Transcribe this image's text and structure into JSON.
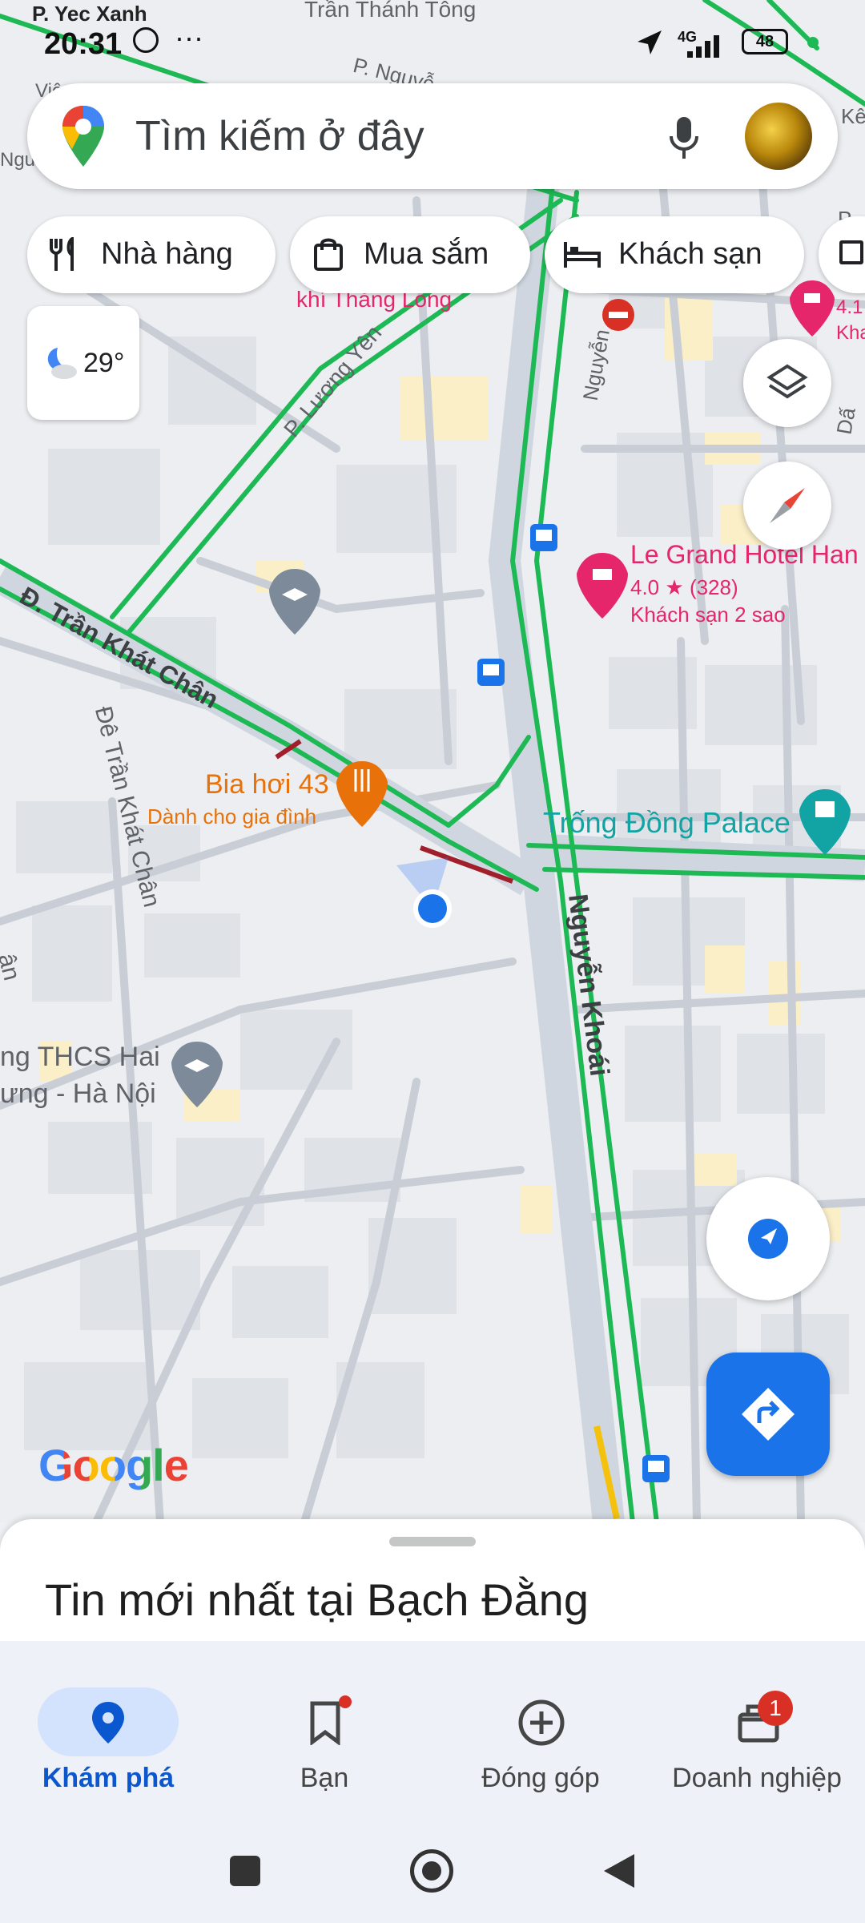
{
  "status_bar": {
    "time": "20:31",
    "network": "4G",
    "battery": "48",
    "location_label": "P. Yec Xanh"
  },
  "search": {
    "placeholder": "Tìm kiếm ở đây"
  },
  "chips": [
    {
      "label": "Nhà hàng",
      "icon": "restaurant-icon"
    },
    {
      "label": "Mua sắm",
      "icon": "shopping-bag-icon"
    },
    {
      "label": "Khách sạn",
      "icon": "hotel-icon"
    }
  ],
  "weather": {
    "temperature": "29°",
    "icon": "night-cloudy-icon"
  },
  "map_labels": {
    "street_tran_thanh_tong": "Trần Thánh Tông",
    "street_p_nguyen": "P. Nguyễ",
    "street_luong_yen": "P. Lương Yên",
    "street_nguyen_top": "Nguyễn",
    "street_tran_khat_chan": "Đ. Trần Khát Chân",
    "street_de_tran_khat_chan": "Đê Trần Khát Chân",
    "street_nguyen_khoai": "Nguyễn Khoái",
    "poi_thang_long": "khí Thăng Long",
    "poi_le_grand": "Le Grand Hotel Han",
    "poi_le_grand_rating": "4.0",
    "poi_le_grand_reviews": "(328)",
    "poi_le_grand_type": "Khách sạn 2 sao",
    "poi_right_rating": "4.1",
    "poi_right_name": "Kha",
    "poi_bia_hoi": "Bia hơi 43",
    "poi_bia_hoi_sub": "Dành cho gia đình",
    "poi_trong_dong": "Trống Đồng Palace",
    "poi_school_line1": "ng THCS Hai",
    "poi_school_line2": "ưng - Hà Nội",
    "edge_left_an": "ân",
    "edge_left_ngu": "Ngu",
    "edge_left_vie": "Việ",
    "edge_right_ke": "Kê",
    "edge_right_p": "P",
    "edge_right_dan": "Dấ"
  },
  "google_logo": "Google",
  "sheet": {
    "title": "Tin mới nhất tại Bạch Đằng"
  },
  "bottom_nav": [
    {
      "label": "Khám phá",
      "icon": "explore-pin-icon",
      "active": true
    },
    {
      "label": "Bạn",
      "icon": "bookmark-icon",
      "active": false
    },
    {
      "label": "Đóng góp",
      "icon": "add-circle-icon",
      "active": false
    },
    {
      "label": "Doanh nghiệp",
      "icon": "business-store-icon",
      "active": false,
      "badge": "1"
    }
  ],
  "colors": {
    "accent_blue": "#1a73e8",
    "traffic_green": "#1db954",
    "poi_pink": "#e5266b",
    "poi_orange": "#e8710a",
    "poi_teal": "#12a4a4",
    "nav_active_bg": "#d3e3fd"
  }
}
